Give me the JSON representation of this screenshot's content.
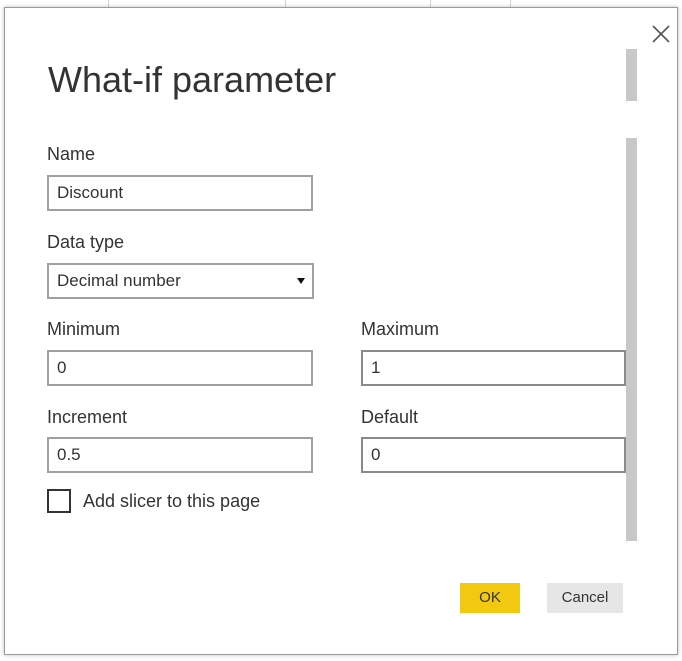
{
  "dialog": {
    "title": "What-if parameter",
    "close_icon": "close-icon"
  },
  "fields": {
    "name": {
      "label": "Name",
      "value": "Discount"
    },
    "data_type": {
      "label": "Data type",
      "value": "Decimal number",
      "arrow_icon": "dropdown-arrow-icon"
    },
    "minimum": {
      "label": "Minimum",
      "value": "0"
    },
    "maximum": {
      "label": "Maximum",
      "value": "1"
    },
    "increment": {
      "label": "Increment",
      "value": "0.5"
    },
    "default": {
      "label": "Default",
      "value": "0"
    }
  },
  "slicer": {
    "label": "Add slicer to this page",
    "checked": false
  },
  "buttons": {
    "ok_label": "OK",
    "cancel_label": "Cancel"
  },
  "colors": {
    "accent": "#F2C811",
    "cancel_bg": "#E6E6E6",
    "text": "#333333",
    "scrollbar": "#C8C8C8"
  }
}
